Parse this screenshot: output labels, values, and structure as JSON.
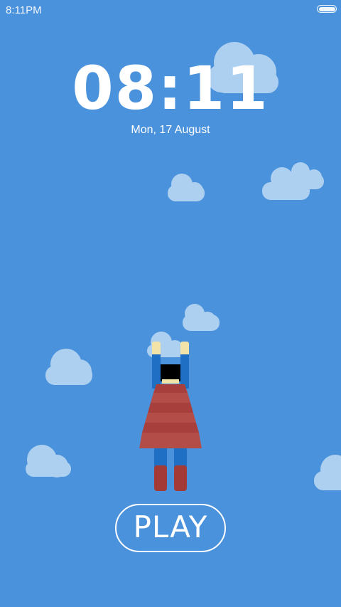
{
  "status_bar": {
    "time": "8:11PM",
    "battery_icon": "battery-full-icon"
  },
  "lock_screen": {
    "clock": "08:11",
    "date": "Mon, 17 August"
  },
  "actions": {
    "play_label": "PLAY"
  },
  "illustration": {
    "subject": "flying-hero-girl",
    "background_color": "#4a92dc",
    "cloud_color": "#b9d7f3",
    "cape_color": "#a7403d",
    "suit_color": "#1f6fc4",
    "boot_color": "#a33a36",
    "skin_color": "#f2e3a8",
    "hair_color": "#000000"
  }
}
